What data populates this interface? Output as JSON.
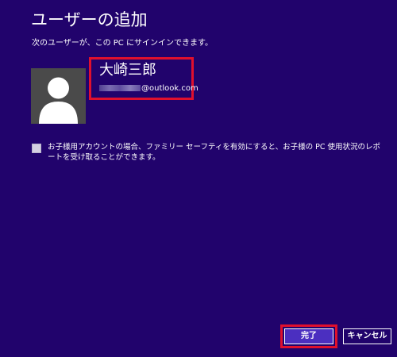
{
  "header": {
    "title": "ユーザーの追加",
    "subtitle": "次のユーザーが、この PC にサインインできます。"
  },
  "user": {
    "name": "大崎三郎",
    "email_domain": "@outlook.com",
    "avatar_icon": "user-silhouette-icon"
  },
  "family_safety": {
    "label": "お子様用アカウントの場合、ファミリー セーフティを有効にすると、お子様の PC 使用状況のレポートを受け取ることができます。",
    "checked": false
  },
  "buttons": {
    "done_label": "完了",
    "cancel_label": "キャンセル"
  },
  "colors": {
    "background": "#21036c",
    "highlight": "#e0102d",
    "primary_button": "#4b2fc0"
  }
}
